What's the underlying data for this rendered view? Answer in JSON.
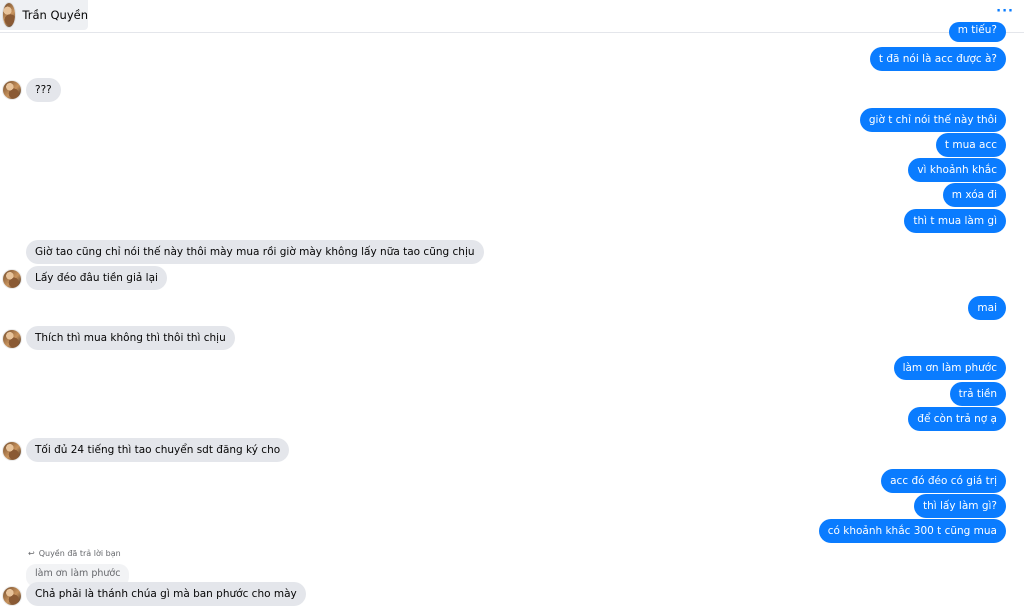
{
  "header": {
    "contact_name": "Trần Quyền",
    "more_icon": "ellipsis-icon"
  },
  "messages": {
    "m00": "m tiếu?",
    "m01": "t đã nói là acc được à?",
    "m02": "???",
    "m03": "giờ t chỉ nói thế này thôi",
    "m04": "t mua acc",
    "m05": "vì khoảnh khắc",
    "m06": "m xóa đi",
    "m07": "thì t mua làm gì",
    "m08": "Giờ tao cũng chỉ nói thế này thôi mày mua rồi giờ mày không lấy nữa tao cũng chịu",
    "m09": "Lấy đéo đâu tiền giả lại",
    "m10": "mai",
    "m11": "Thích thì mua không thì thôi thì chịu",
    "m12": "làm ơn làm phước",
    "m13": "trả tiền",
    "m14": "để còn trả nợ ạ",
    "m15": "Tối đủ 24 tiếng thì tao chuyển sdt đăng ký cho",
    "m16": "acc đó đéo có giá trị",
    "m17": "thì lấy làm gì?",
    "m18": "có khoảnh khắc 300 t cũng mua",
    "m19": "Chả phải là thánh chúa gì mà ban phước cho mày"
  },
  "reply": {
    "note": "Quyền đã trả lời bạn",
    "quoted": "làm ơn làm phước"
  },
  "colors": {
    "outgoing": "#0a7cff",
    "incoming": "#e4e6eb"
  }
}
